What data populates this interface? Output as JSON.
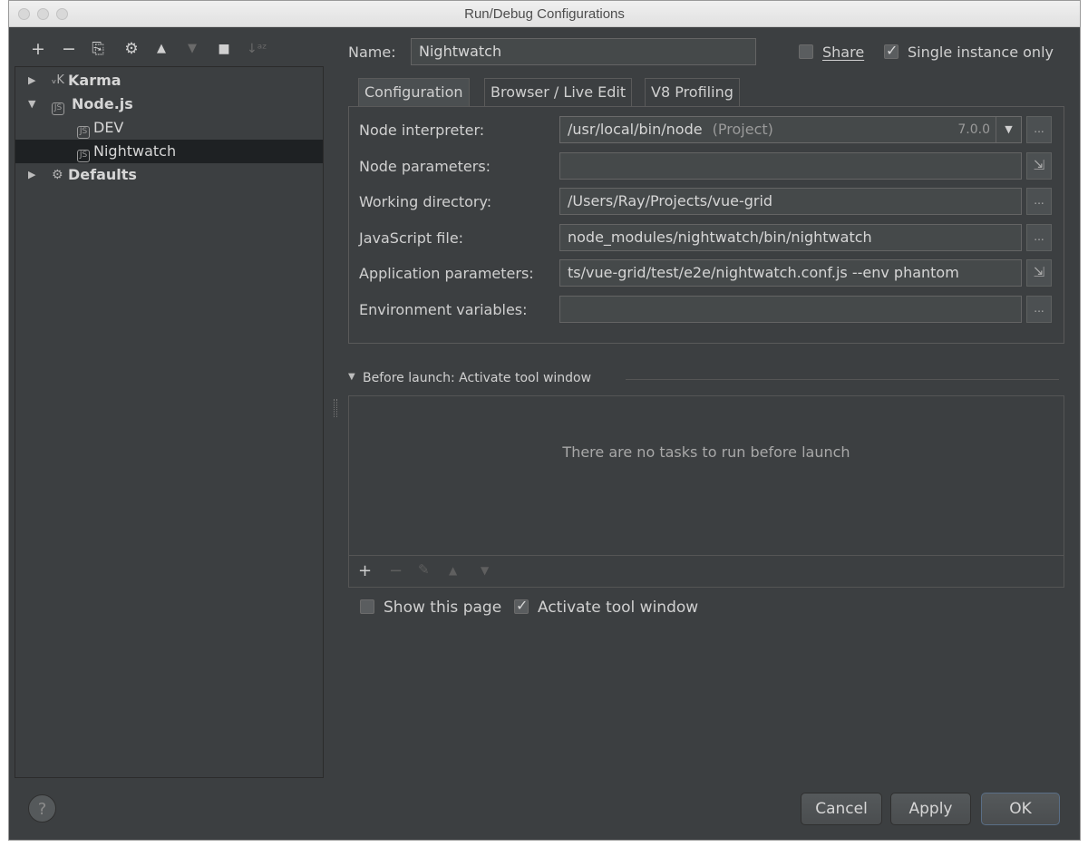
{
  "window": {
    "title": "Run/Debug Configurations"
  },
  "toolbar": {
    "add": "+",
    "remove": "−",
    "copy": "⎘",
    "edit_defaults": "⚙",
    "move_up": "▲",
    "move_down": "▼",
    "folder": "■",
    "sort": "↓ᵃᶻ"
  },
  "tree": {
    "items": [
      {
        "label": "Karma",
        "icon": "karma-icon"
      },
      {
        "label": "Node.js",
        "icon": "nodejs-icon"
      },
      {
        "label": "DEV",
        "icon": "nodejs-icon"
      },
      {
        "label": "Nightwatch",
        "icon": "nodejs-icon"
      },
      {
        "label": "Defaults",
        "icon": "wrench-icon"
      }
    ]
  },
  "name": {
    "label": "Name:",
    "value": "Nightwatch"
  },
  "share": {
    "label": "Share",
    "checked": false
  },
  "single_instance": {
    "label": "Single instance only",
    "checked": true
  },
  "tabs": [
    {
      "label": "Configuration",
      "active": true
    },
    {
      "label": "Browser / Live Edit",
      "active": false
    },
    {
      "label": "V8 Profiling",
      "active": false
    }
  ],
  "config": {
    "node_interpreter": {
      "label": "Node interpreter:",
      "value": "/usr/local/bin/node",
      "suffix": "(Project)",
      "version": "7.0.0"
    },
    "node_parameters": {
      "label": "Node parameters:",
      "value": ""
    },
    "working_directory": {
      "label": "Working directory:",
      "value": "/Users/Ray/Projects/vue-grid"
    },
    "javascript_file": {
      "label": "JavaScript file:",
      "value": "node_modules/nightwatch/bin/nightwatch"
    },
    "application_parameters": {
      "label": "Application parameters:",
      "value": "ts/vue-grid/test/e2e/nightwatch.conf.js --env phantom"
    },
    "environment_variables": {
      "label": "Environment variables:",
      "value": ""
    }
  },
  "before_launch": {
    "title": "Before launch: Activate tool window",
    "empty_text": "There are no tasks to run before launch"
  },
  "show_page": {
    "label": "Show this page",
    "checked": false
  },
  "activate_tool": {
    "label": "Activate tool window",
    "checked": true
  },
  "buttons": {
    "cancel": "Cancel",
    "apply": "Apply",
    "ok": "OK",
    "help": "?"
  },
  "ellipsis": "..."
}
